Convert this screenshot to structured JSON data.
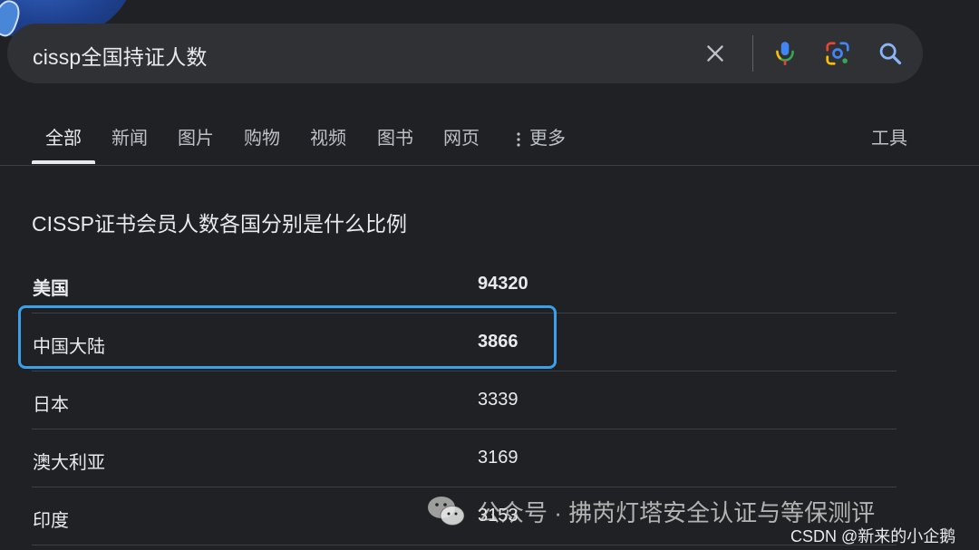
{
  "search": {
    "query": "cissp全国持证人数"
  },
  "tabs": [
    {
      "label": "全部",
      "active": true
    },
    {
      "label": "新闻",
      "active": false
    },
    {
      "label": "图片",
      "active": false
    },
    {
      "label": "购物",
      "active": false
    },
    {
      "label": "视频",
      "active": false
    },
    {
      "label": "图书",
      "active": false
    },
    {
      "label": "网页",
      "active": false
    }
  ],
  "more_label": "更多",
  "tools_label": "工具",
  "snippet": {
    "title": "CISSP证书会员人数各国分别是什么比例",
    "rows": [
      {
        "country": "美国",
        "value": "94320"
      },
      {
        "country": "中国大陆",
        "value": "3866"
      },
      {
        "country": "日本",
        "value": "3339"
      },
      {
        "country": "澳大利亚",
        "value": "3169"
      },
      {
        "country": "印度",
        "value": "3153"
      }
    ]
  },
  "watermark": {
    "text": "公众号 · 拂芮灯塔安全认证与等保测评"
  },
  "csdn_mark": "CSDN @新来的小企鹅",
  "colors": {
    "background": "#202124",
    "search_bar": "#303134",
    "highlight": "#3aa0e8",
    "mic_blue": "#4285f4",
    "mic_red": "#ea4335",
    "lens_yellow": "#fbbc04",
    "lens_green": "#34a853",
    "search_icon": "#8ab4f8"
  },
  "icons": {
    "clear": "close-icon",
    "mic": "microphone-icon",
    "lens": "google-lens-icon",
    "search": "search-icon",
    "more": "vertical-dots-icon",
    "wechat": "wechat-icon"
  }
}
